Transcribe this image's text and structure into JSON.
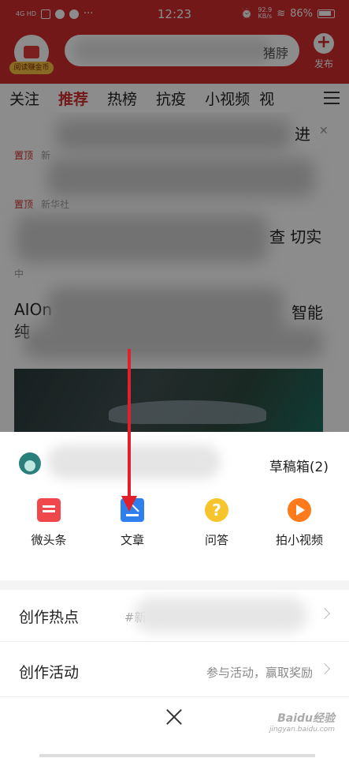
{
  "status_bar": {
    "time": "12:23",
    "speed_top": "92.9",
    "speed_unit": "KB/s",
    "battery": "86%",
    "network": "4G HD"
  },
  "header": {
    "coin_label": "阅读赚金币",
    "search_placeholder_tail": "猪脖",
    "publish_label": "发布"
  },
  "tabs": [
    "关注",
    "推荐",
    "热榜",
    "抗疫",
    "小视频",
    "视"
  ],
  "active_tab": "推荐",
  "feed": {
    "pinned_1": "置顶",
    "pinned_1_tail": "新",
    "pinned_2": "置顶",
    "pinned_2_tail": "新华社",
    "line_1_tail": "进",
    "line_2_tail": "查 切实",
    "source_head": "中",
    "line_3_head": "AIOn",
    "line_3_tail": "智能",
    "line_4_head": "纯"
  },
  "sheet": {
    "drafts_label": "草稿箱(2)",
    "actions": [
      {
        "label": "微头条",
        "icon": "micro-headline-icon"
      },
      {
        "label": "文章",
        "icon": "article-icon"
      },
      {
        "label": "问答",
        "icon": "qa-icon"
      },
      {
        "label": "拍小视频",
        "icon": "short-video-icon"
      }
    ],
    "rows": [
      {
        "title": "创作热点",
        "hint": "#新"
      },
      {
        "title": "创作活动",
        "hint": "参与活动，赢取奖励"
      }
    ]
  },
  "watermark": {
    "brand": "Baidu经验",
    "url": "jingyan.baidu.com"
  },
  "colors": {
    "brand_red": "#d22c2f",
    "annotation_arrow": "#e0202a"
  }
}
